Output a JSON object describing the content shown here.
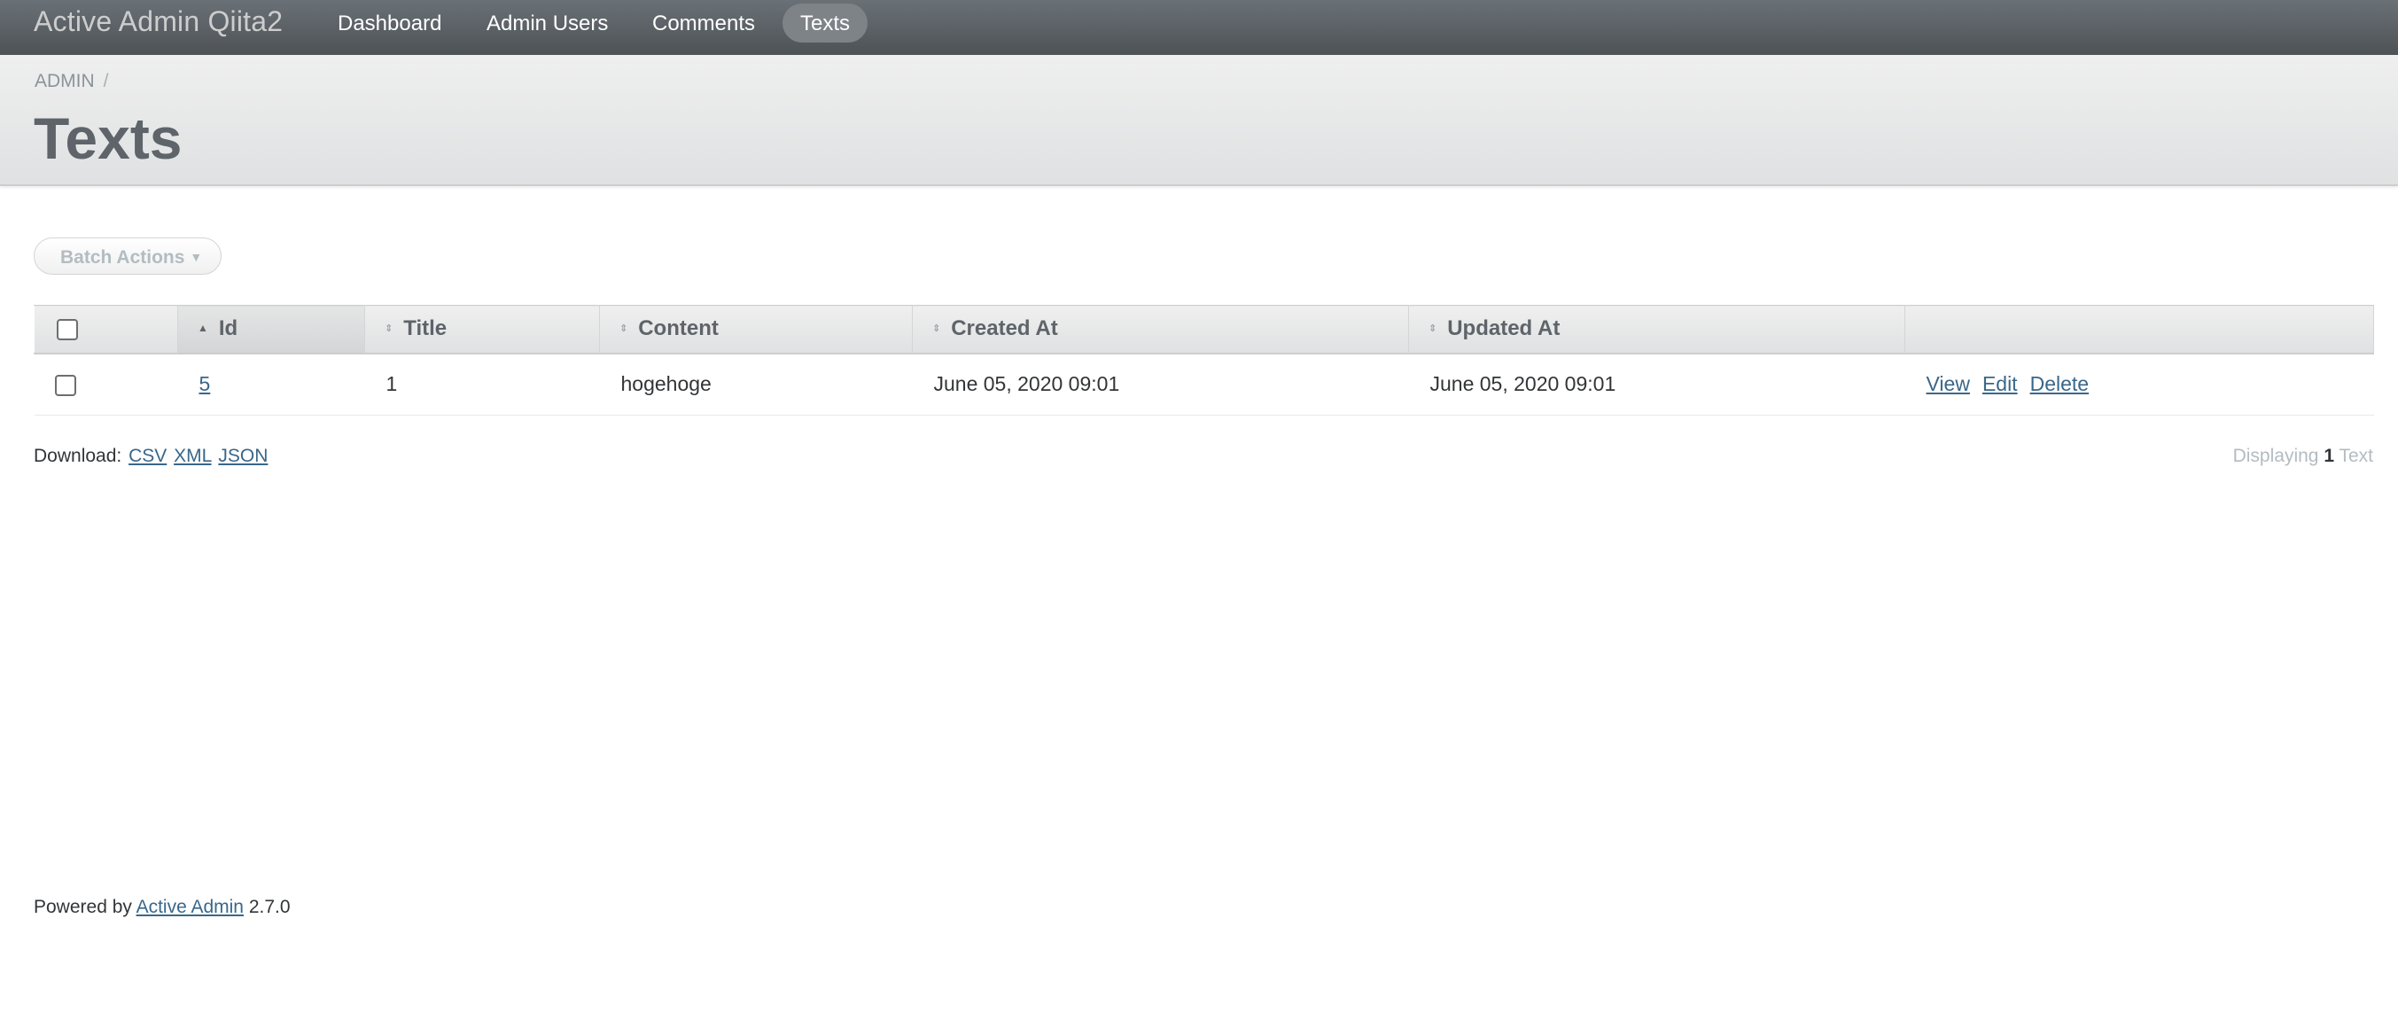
{
  "header": {
    "site_title": "Active Admin Qiita2",
    "nav": [
      {
        "label": "Dashboard"
      },
      {
        "label": "Admin Users"
      },
      {
        "label": "Comments"
      },
      {
        "label": "Texts",
        "current": true
      }
    ]
  },
  "title_bar": {
    "breadcrumb": [
      "ADMIN",
      "/"
    ],
    "title": "Texts"
  },
  "batch_actions": {
    "label": "Batch Actions",
    "caret": "▼"
  },
  "table": {
    "columns": [
      "Id",
      "Title",
      "Content",
      "Created At",
      "Updated At",
      ""
    ],
    "sort_column": "Id",
    "sort_direction": "asc",
    "rows": [
      {
        "id": "5",
        "title": "1",
        "content": "hogehoge",
        "created_at": "June 05, 2020 09:01",
        "updated_at": "June 05, 2020 09:01",
        "actions": [
          "View",
          "Edit",
          "Delete"
        ]
      }
    ]
  },
  "download": {
    "label": "Download:",
    "formats": [
      "CSV",
      "XML",
      "JSON"
    ]
  },
  "pagination_info": {
    "prefix": "Displaying",
    "count": "1",
    "suffix": "Text"
  },
  "footer": {
    "prefix": "Powered by",
    "link": "Active Admin",
    "version": "2.7.0"
  },
  "colors": {
    "header_bg": "#5a6064",
    "link": "#38678b",
    "title": "#5e6469"
  },
  "icons": {
    "sort_asc": "triangle-up-icon",
    "sortable": "sort-arrows-icon",
    "dropdown": "caret-down-icon"
  }
}
